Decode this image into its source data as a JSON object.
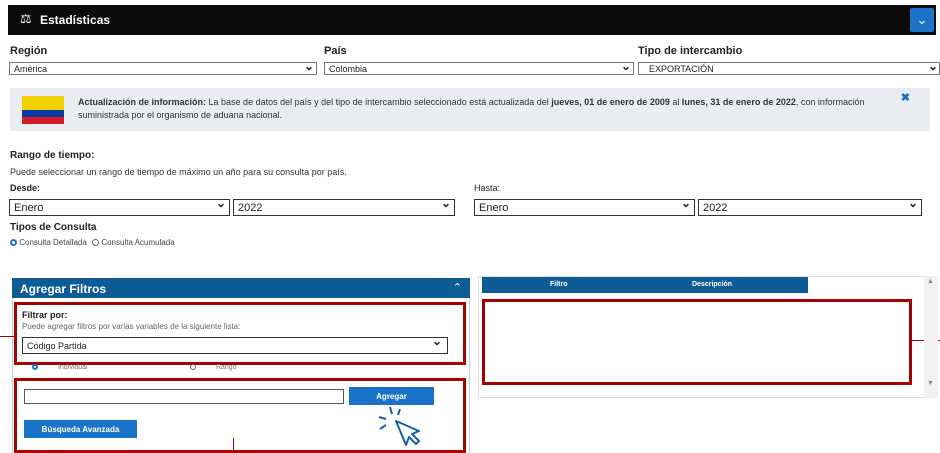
{
  "header": {
    "title": "Estadísticas"
  },
  "region": {
    "label": "Región",
    "value": "América"
  },
  "pais": {
    "label": "País",
    "value": "Colombia"
  },
  "tipo_intercambio": {
    "label": "Tipo de intercambio",
    "value": "EXPORTACIÓN"
  },
  "banner": {
    "prefix": "Actualización de información:",
    "text1": " La base de datos del país y del tipo de intercambio seleccionado está actualizada del ",
    "date_from": "jueves, 01 de enero de 2009",
    "text2": " al ",
    "date_to": "lunes, 31 de enero de 2022",
    "text3": ", con información suministrada por el organismo de aduana nacional.",
    "flag_colors": [
      "#f5d000",
      "#0a3aa6",
      "#d51d22"
    ]
  },
  "rango": {
    "title": "Rango de tiempo:",
    "desc": "Puede seleccionar un rango de tiempo de máximo un año para su consulta por país.",
    "desde_label": "Desde:",
    "hasta_label": "Hasta:",
    "desde_mes": "Enero",
    "desde_anio": "2022",
    "hasta_mes": "Enero",
    "hasta_anio": "2022"
  },
  "tipos": {
    "title": "Tipos de Consulta",
    "opt1": "Consulta Detallada",
    "opt2": "Consulta Acumulada"
  },
  "filtros": {
    "title": "Agregar Filtros",
    "filtrar_por": "Filtrar por:",
    "hint": "Puede agregar filtros por varias variables de la siguiente lista:",
    "variable": "Código Partida",
    "radio1": "Individual",
    "radio2": "Rango",
    "agregar": "Agregar",
    "busqueda": "Búsqueda Avanzada"
  },
  "tabla": {
    "col1": "Filtro",
    "col2": "Descripción"
  }
}
